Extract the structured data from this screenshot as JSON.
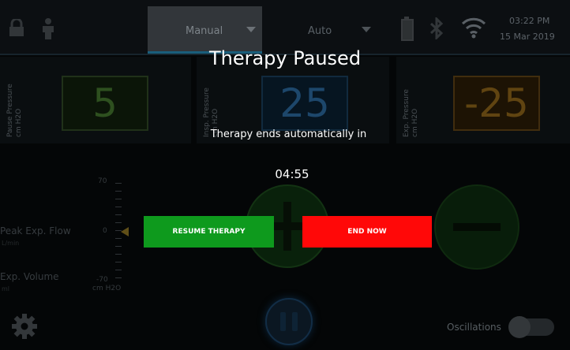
{
  "header": {
    "tabs": [
      {
        "label": "Manual",
        "active": true
      },
      {
        "label": "Auto",
        "active": false
      }
    ],
    "status_icons": [
      "lock-icon",
      "person-icon",
      "battery-icon",
      "bluetooth-icon",
      "wifi-icon"
    ],
    "clock": {
      "time": "03:22 PM",
      "date": "15 Mar 2019"
    }
  },
  "pressure_cards": [
    {
      "label_line1": "Pause Pressure",
      "label_line2": "cm H2O",
      "value": "5",
      "color": "#3fae2a"
    },
    {
      "label_line1": "Insp. Pressure",
      "label_line2": "cm H2O",
      "value": "25",
      "color": "#2a7fc8"
    },
    {
      "label_line1": "Exp. Pressure",
      "label_line2": "cm H2O",
      "value": "-25",
      "color": "#d98e17"
    }
  ],
  "gauge": {
    "rows": [
      {
        "label": "Peak Exp. Flow",
        "sub": "L/min"
      },
      {
        "label": "Exp. Volume",
        "sub": "ml"
      }
    ],
    "ticks": [
      "70",
      "0",
      "-70"
    ],
    "unit": "cm H2O"
  },
  "controls": {
    "oscillations_label": "Oscillations",
    "oscillations_on": false
  },
  "modal": {
    "title": "Therapy Paused",
    "subtitle": "Therapy ends automatically in",
    "countdown": "04:55",
    "resume_label": "RESUME THERAPY",
    "end_label": "END NOW",
    "resume_color": "#0e9a1d",
    "end_color": "#ff0808"
  }
}
